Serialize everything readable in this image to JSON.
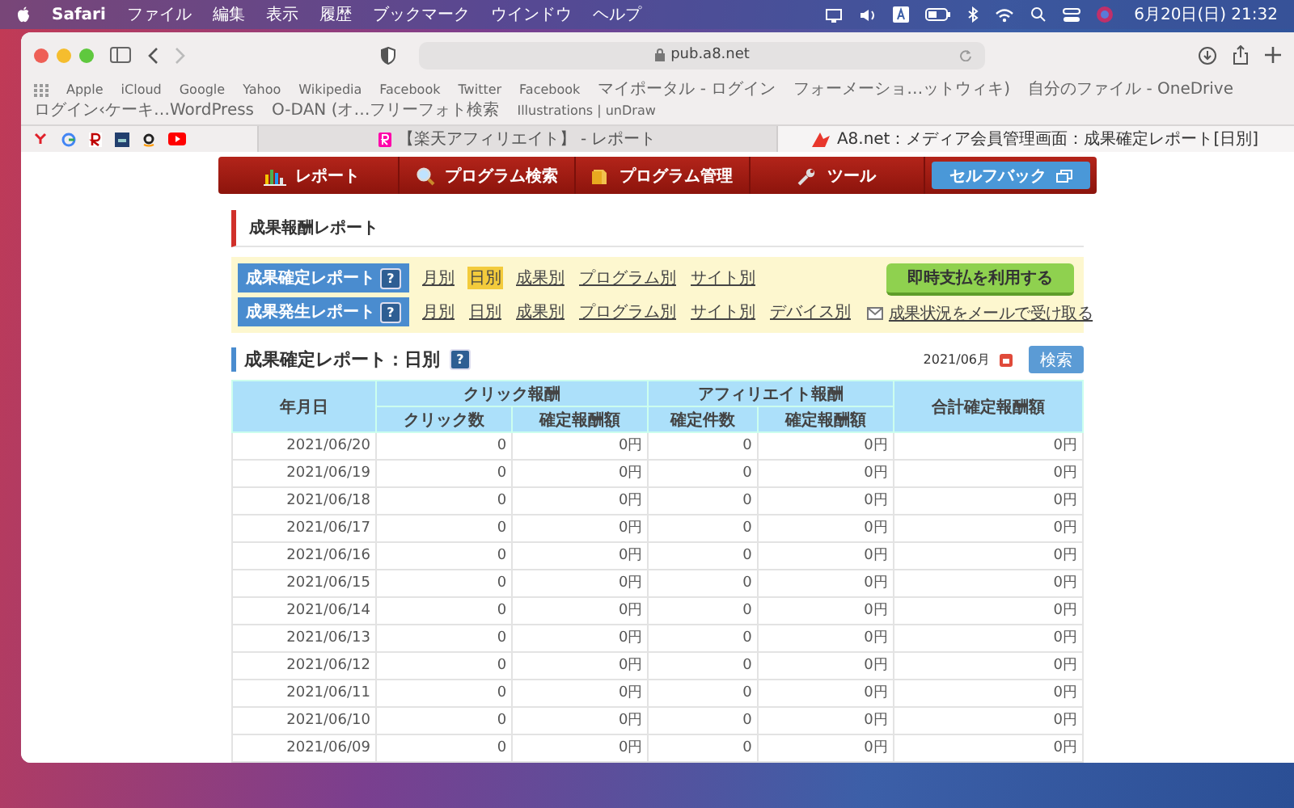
{
  "menu_bar": {
    "app": "Safari",
    "items": [
      "ファイル",
      "編集",
      "表示",
      "履歴",
      "ブックマーク",
      "ウインドウ",
      "ヘルプ"
    ],
    "clock": "6月20日(日) 21:32"
  },
  "address_bar": {
    "url": "pub.a8.net"
  },
  "bookmarks": [
    "Apple",
    "iCloud",
    "Google",
    "Yahoo",
    "Wikipedia",
    "Facebook",
    "Twitter",
    "Facebook",
    "マイポータル - ログイン",
    "フォーメーショ…ットウィキ)",
    "自分のファイル - OneDrive",
    "ログイン‹ケーキ…WordPress",
    "O-DAN (オ…フリーフォト検索",
    "Illustrations | unDraw"
  ],
  "tabs": [
    {
      "title": "【楽天アフィリエイト】 - レポート",
      "selected": false
    },
    {
      "title": "A8.net：メディア会員管理画面：成果確定レポート[日別]",
      "selected": true
    }
  ],
  "nav": [
    {
      "kind": "chart",
      "label": "レポート"
    },
    {
      "kind": "search",
      "label": "プログラム検索"
    },
    {
      "kind": "tag",
      "label": "プログラム管理"
    },
    {
      "kind": "wrench",
      "label": "ツール"
    },
    {
      "kind": "special",
      "label": "セルフバック"
    }
  ],
  "section_title": "成果報酬レポート",
  "report_rows": [
    {
      "label": "成果確定レポート",
      "help": "?",
      "links": [
        {
          "label": "月別",
          "selected": false
        },
        {
          "label": "日別",
          "selected": true
        },
        {
          "label": "成果別",
          "selected": false
        },
        {
          "label": "プログラム別",
          "selected": false
        },
        {
          "label": "サイト別",
          "selected": false
        }
      ]
    },
    {
      "label": "成果発生レポート",
      "help": "?",
      "links": [
        {
          "label": "月別",
          "selected": false
        },
        {
          "label": "日別",
          "selected": false
        },
        {
          "label": "成果別",
          "selected": false
        },
        {
          "label": "プログラム別",
          "selected": false
        },
        {
          "label": "サイト別",
          "selected": false
        },
        {
          "label": "デバイス別",
          "selected": false
        }
      ]
    }
  ],
  "pay_button": "即時支払を利用する",
  "mail_link": "成果状況をメールで受け取る",
  "report": {
    "title": "成果確定レポート：日別",
    "help": "?",
    "month": "2021/06月",
    "search_button": "検索"
  },
  "table": {
    "first_column": "年月日",
    "groups": [
      {
        "label": "クリック報酬",
        "columns": [
          "クリック数",
          "確定報酬額"
        ]
      },
      {
        "label": "アフィリエイト報酬",
        "columns": [
          "確定件数",
          "確定報酬額"
        ]
      }
    ],
    "last_column": "合計確定報酬額",
    "rows": [
      [
        "2021/06/20",
        "0",
        "0円",
        "0",
        "0円",
        "0円"
      ],
      [
        "2021/06/19",
        "0",
        "0円",
        "0",
        "0円",
        "0円"
      ],
      [
        "2021/06/18",
        "0",
        "0円",
        "0",
        "0円",
        "0円"
      ],
      [
        "2021/06/17",
        "0",
        "0円",
        "0",
        "0円",
        "0円"
      ],
      [
        "2021/06/16",
        "0",
        "0円",
        "0",
        "0円",
        "0円"
      ],
      [
        "2021/06/15",
        "0",
        "0円",
        "0",
        "0円",
        "0円"
      ],
      [
        "2021/06/14",
        "0",
        "0円",
        "0",
        "0円",
        "0円"
      ],
      [
        "2021/06/13",
        "0",
        "0円",
        "0",
        "0円",
        "0円"
      ],
      [
        "2021/06/12",
        "0",
        "0円",
        "0",
        "0円",
        "0円"
      ],
      [
        "2021/06/11",
        "0",
        "0円",
        "0",
        "0円",
        "0円"
      ],
      [
        "2021/06/10",
        "0",
        "0円",
        "0",
        "0円",
        "0円"
      ],
      [
        "2021/06/09",
        "0",
        "0円",
        "0",
        "0円",
        "0円"
      ]
    ]
  }
}
